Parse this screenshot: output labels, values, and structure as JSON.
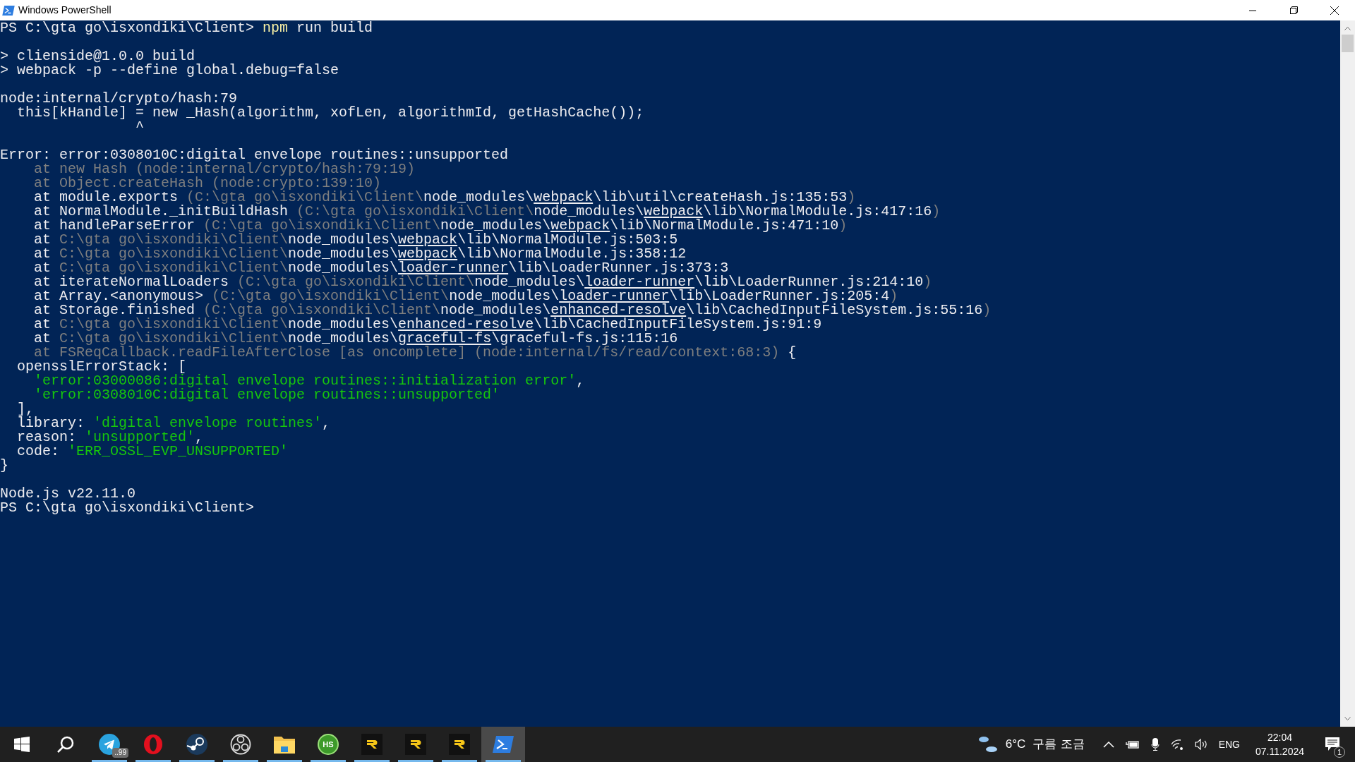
{
  "window": {
    "title": "Windows PowerShell"
  },
  "terminal": {
    "blocks": [
      [
        [
          {
            "kind": "plain",
            "text": "PS C:\\gta go\\isxondiki\\Client> "
          },
          {
            "kind": "command",
            "text": "npm"
          },
          {
            "kind": "plain",
            "text": " run build"
          }
        ]
      ],
      [
        [
          {
            "kind": "plain",
            "text": "> clienside@1.0.0 build"
          }
        ],
        [
          {
            "kind": "plain",
            "text": "> webpack -p --define global.debug=false"
          }
        ]
      ],
      [
        [
          {
            "kind": "plain",
            "text": "node:internal/crypto/hash:79"
          }
        ],
        [
          {
            "kind": "plain",
            "text": "  this[kHandle] = new _Hash(algorithm, xofLen, algorithmId, getHashCache());"
          }
        ],
        [
          {
            "kind": "plain",
            "text": "                ^"
          }
        ]
      ],
      [
        [
          {
            "kind": "plain",
            "text": "Error: error:0308010C:digital envelope routines::unsupported"
          }
        ],
        [
          {
            "kind": "dim",
            "text": "    at new Hash (node:internal/crypto/hash:79:19)"
          }
        ],
        [
          {
            "kind": "dim",
            "text": "    at Object.createHash (node:crypto:139:10)"
          }
        ],
        [
          {
            "kind": "plain",
            "text": "    at module.exports "
          },
          {
            "kind": "dim",
            "text": "(C:\\gta go\\isxondiki\\Client\\"
          },
          {
            "kind": "plain",
            "text": "node_modules\\"
          },
          {
            "kind": "underlined",
            "text": "webpack"
          },
          {
            "kind": "plain",
            "text": "\\lib\\util\\createHash.js:135:53"
          },
          {
            "kind": "dim",
            "text": ")"
          }
        ],
        [
          {
            "kind": "plain",
            "text": "    at NormalModule._initBuildHash "
          },
          {
            "kind": "dim",
            "text": "(C:\\gta go\\isxondiki\\Client\\"
          },
          {
            "kind": "plain",
            "text": "node_modules\\"
          },
          {
            "kind": "underlined",
            "text": "webpack"
          },
          {
            "kind": "plain",
            "text": "\\lib\\NormalModule.js:417:16"
          },
          {
            "kind": "dim",
            "text": ")"
          }
        ],
        [
          {
            "kind": "plain",
            "text": "    at handleParseError "
          },
          {
            "kind": "dim",
            "text": "(C:\\gta go\\isxondiki\\Client\\"
          },
          {
            "kind": "plain",
            "text": "node_modules\\"
          },
          {
            "kind": "underlined",
            "text": "webpack"
          },
          {
            "kind": "plain",
            "text": "\\lib\\NormalModule.js:471:10"
          },
          {
            "kind": "dim",
            "text": ")"
          }
        ],
        [
          {
            "kind": "plain",
            "text": "    at "
          },
          {
            "kind": "dim",
            "text": "C:\\gta go\\isxondiki\\Client\\"
          },
          {
            "kind": "plain",
            "text": "node_modules\\"
          },
          {
            "kind": "underlined",
            "text": "webpack"
          },
          {
            "kind": "plain",
            "text": "\\lib\\NormalModule.js:503:5"
          }
        ],
        [
          {
            "kind": "plain",
            "text": "    at "
          },
          {
            "kind": "dim",
            "text": "C:\\gta go\\isxondiki\\Client\\"
          },
          {
            "kind": "plain",
            "text": "node_modules\\"
          },
          {
            "kind": "underlined",
            "text": "webpack"
          },
          {
            "kind": "plain",
            "text": "\\lib\\NormalModule.js:358:12"
          }
        ],
        [
          {
            "kind": "plain",
            "text": "    at "
          },
          {
            "kind": "dim",
            "text": "C:\\gta go\\isxondiki\\Client\\"
          },
          {
            "kind": "plain",
            "text": "node_modules\\"
          },
          {
            "kind": "underlined",
            "text": "loader-runner"
          },
          {
            "kind": "plain",
            "text": "\\lib\\LoaderRunner.js:373:3"
          }
        ],
        [
          {
            "kind": "plain",
            "text": "    at iterateNormalLoaders "
          },
          {
            "kind": "dim",
            "text": "(C:\\gta go\\isxondiki\\Client\\"
          },
          {
            "kind": "plain",
            "text": "node_modules\\"
          },
          {
            "kind": "underlined",
            "text": "loader-runner"
          },
          {
            "kind": "plain",
            "text": "\\lib\\LoaderRunner.js:214:10"
          },
          {
            "kind": "dim",
            "text": ")"
          }
        ],
        [
          {
            "kind": "plain",
            "text": "    at Array.<anonymous> "
          },
          {
            "kind": "dim",
            "text": "(C:\\gta go\\isxondiki\\Client\\"
          },
          {
            "kind": "plain",
            "text": "node_modules\\"
          },
          {
            "kind": "underlined",
            "text": "loader-runner"
          },
          {
            "kind": "plain",
            "text": "\\lib\\LoaderRunner.js:205:4"
          },
          {
            "kind": "dim",
            "text": ")"
          }
        ],
        [
          {
            "kind": "plain",
            "text": "    at Storage.finished "
          },
          {
            "kind": "dim",
            "text": "(C:\\gta go\\isxondiki\\Client\\"
          },
          {
            "kind": "plain",
            "text": "node_modules\\"
          },
          {
            "kind": "underlined",
            "text": "enhanced-resolve"
          },
          {
            "kind": "plain",
            "text": "\\lib\\CachedInputFileSystem.js:55:16"
          },
          {
            "kind": "dim",
            "text": ")"
          }
        ],
        [
          {
            "kind": "plain",
            "text": "    at "
          },
          {
            "kind": "dim",
            "text": "C:\\gta go\\isxondiki\\Client\\"
          },
          {
            "kind": "plain",
            "text": "node_modules\\"
          },
          {
            "kind": "underlined",
            "text": "enhanced-resolve"
          },
          {
            "kind": "plain",
            "text": "\\lib\\CachedInputFileSystem.js:91:9"
          }
        ],
        [
          {
            "kind": "plain",
            "text": "    at "
          },
          {
            "kind": "dim",
            "text": "C:\\gta go\\isxondiki\\Client\\"
          },
          {
            "kind": "plain",
            "text": "node_modules\\"
          },
          {
            "kind": "underlined",
            "text": "graceful-fs"
          },
          {
            "kind": "plain",
            "text": "\\graceful-fs.js:115:16"
          }
        ],
        [
          {
            "kind": "dim",
            "text": "    at FSReqCallback.readFileAfterClose [as oncomplete] (node:internal/fs/read/context:68:3)"
          },
          {
            "kind": "plain",
            "text": " {"
          }
        ],
        [
          {
            "kind": "plain",
            "text": "  opensslErrorStack: ["
          }
        ],
        [
          {
            "kind": "string",
            "text": "    'error:03000086:digital envelope routines::initialization error'"
          },
          {
            "kind": "plain",
            "text": ","
          }
        ],
        [
          {
            "kind": "string",
            "text": "    'error:0308010C:digital envelope routines::unsupported'"
          }
        ],
        [
          {
            "kind": "plain",
            "text": "  ],"
          }
        ],
        [
          {
            "kind": "plain",
            "text": "  library: "
          },
          {
            "kind": "string",
            "text": "'digital envelope routines'"
          },
          {
            "kind": "plain",
            "text": ","
          }
        ],
        [
          {
            "kind": "plain",
            "text": "  reason: "
          },
          {
            "kind": "string",
            "text": "'unsupported'"
          },
          {
            "kind": "plain",
            "text": ","
          }
        ],
        [
          {
            "kind": "plain",
            "text": "  code: "
          },
          {
            "kind": "string",
            "text": "'ERR_OSSL_EVP_UNSUPPORTED'"
          }
        ],
        [
          {
            "kind": "plain",
            "text": "}"
          }
        ]
      ],
      [
        [
          {
            "kind": "plain",
            "text": "Node.js v22.11.0"
          }
        ],
        [
          {
            "kind": "plain",
            "text": "PS C:\\gta go\\isxondiki\\Client>"
          }
        ]
      ]
    ]
  },
  "taskbar": {
    "apps": [
      {
        "kind": "start",
        "running": false,
        "selected": false
      },
      {
        "kind": "search",
        "running": false,
        "selected": false
      },
      {
        "kind": "telegram",
        "running": true,
        "selected": false,
        "badge": "..99"
      },
      {
        "kind": "opera",
        "running": true,
        "selected": false
      },
      {
        "kind": "steam",
        "running": true,
        "selected": false
      },
      {
        "kind": "obs",
        "running": true,
        "selected": false
      },
      {
        "kind": "folder",
        "running": true,
        "selected": false
      },
      {
        "kind": "hs",
        "running": true,
        "selected": false,
        "label": "HS"
      },
      {
        "kind": "r",
        "running": true,
        "selected": false
      },
      {
        "kind": "r",
        "running": true,
        "selected": false
      },
      {
        "kind": "r",
        "running": true,
        "selected": false
      },
      {
        "kind": "powershell",
        "running": true,
        "selected": true
      }
    ],
    "weather": {
      "temperature": "6°C",
      "condition": "구름 조금"
    },
    "language": "ENG",
    "time": "22:04",
    "date": "07.11.2024",
    "notifications": "1"
  }
}
